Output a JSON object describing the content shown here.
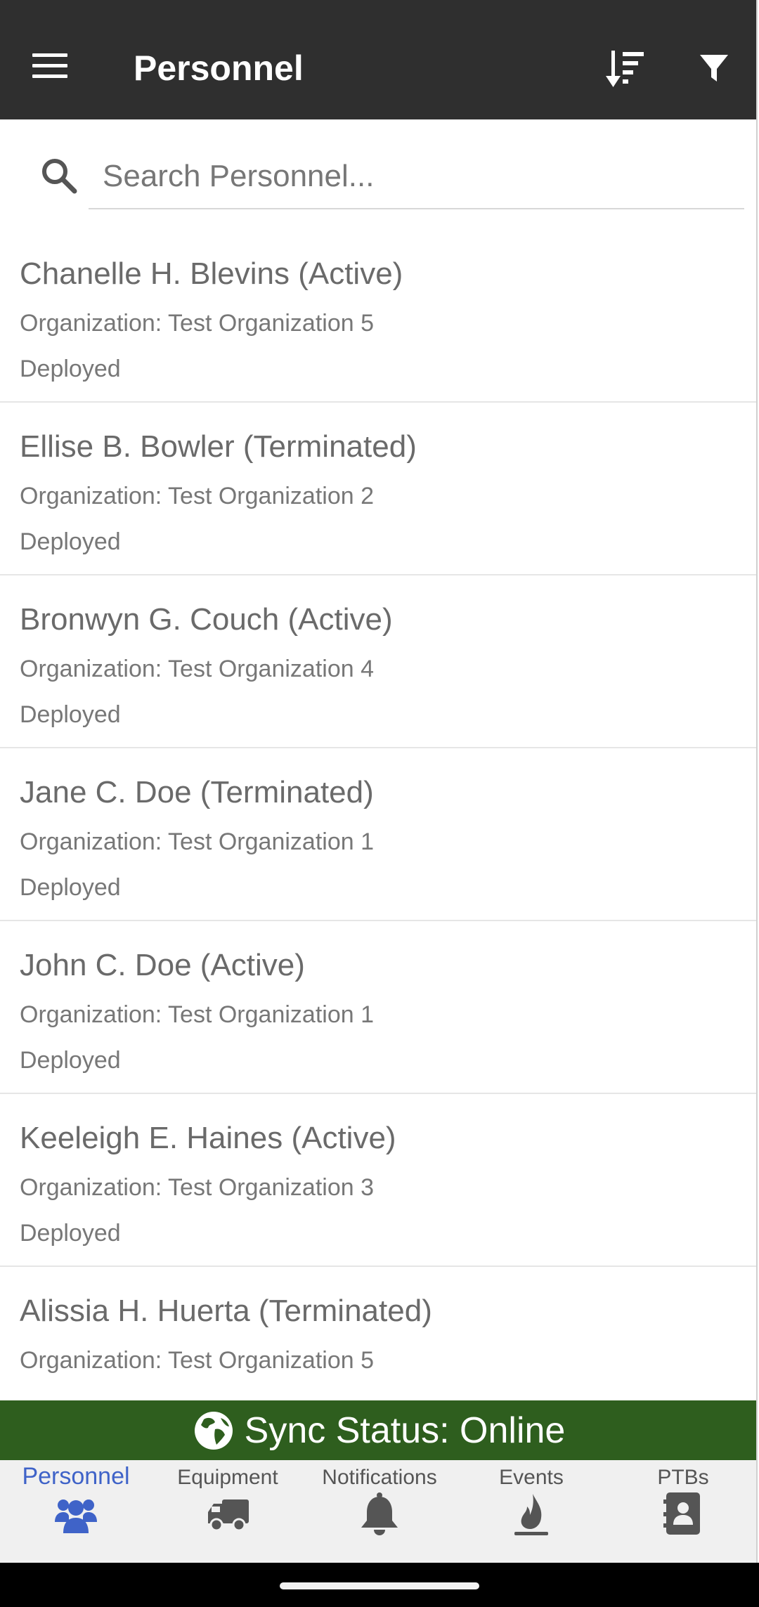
{
  "appbar": {
    "title": "Personnel",
    "menu_icon": "hamburger-menu-icon",
    "sort_icon": "sort-descending-icon",
    "filter_icon": "filter-funnel-icon",
    "background": "#2f2f2f"
  },
  "search": {
    "placeholder": "Search Personnel...",
    "value": "",
    "icon": "search-icon"
  },
  "personnel": [
    {
      "name": "Chanelle H. Blevins (Active)",
      "organization": "Organization: Test Organization 5",
      "status": "Deployed"
    },
    {
      "name": "Ellise B. Bowler (Terminated)",
      "organization": "Organization: Test Organization 2",
      "status": "Deployed"
    },
    {
      "name": "Bronwyn G. Couch (Active)",
      "organization": "Organization: Test Organization 4",
      "status": "Deployed"
    },
    {
      "name": "Jane C. Doe (Terminated)",
      "organization": "Organization: Test Organization 1",
      "status": "Deployed"
    },
    {
      "name": "John C. Doe (Active)",
      "organization": "Organization: Test Organization 1",
      "status": "Deployed"
    },
    {
      "name": "Keeleigh E. Haines (Active)",
      "organization": "Organization: Test Organization 3",
      "status": "Deployed"
    },
    {
      "name": "Alissia H. Huerta (Terminated)",
      "organization": "Organization: Test Organization 5",
      "status": ""
    }
  ],
  "sync": {
    "label": "Sync Status: Online",
    "icon": "globe-icon",
    "color": "#2e5e1e"
  },
  "tabs": [
    {
      "label": "Personnel",
      "icon": "users-icon",
      "active": true
    },
    {
      "label": "Equipment",
      "icon": "truck-icon",
      "active": false
    },
    {
      "label": "Notifications",
      "icon": "bell-icon",
      "active": false
    },
    {
      "label": "Events",
      "icon": "fire-icon",
      "active": false
    },
    {
      "label": "PTBs",
      "icon": "address-book-icon",
      "active": false
    }
  ],
  "colors": {
    "active_tab": "#3f63c8",
    "inactive_tab": "#555555"
  }
}
